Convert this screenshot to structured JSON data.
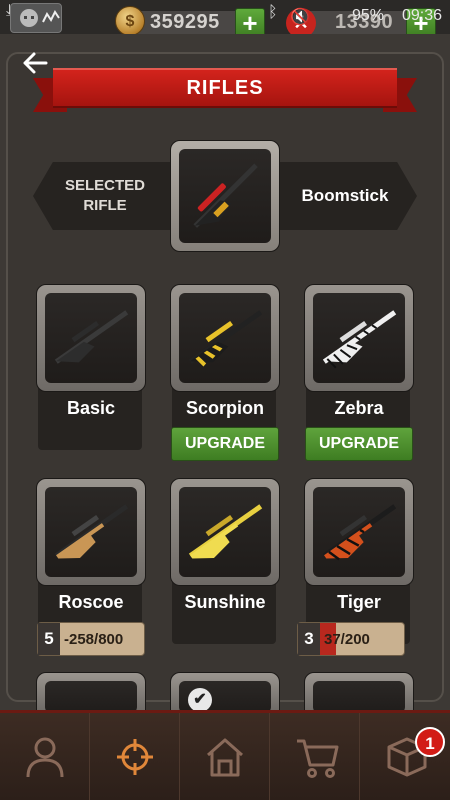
{
  "status_bar": {
    "coins": "359295",
    "tickets": "13390",
    "battery": "95%",
    "time": "09:36",
    "icons": [
      "download-icon",
      "android-app-icon",
      "stats-icon",
      "bluetooth-icon",
      "mute-icon",
      "wifi-icon",
      "signal-icon",
      "battery-icon"
    ]
  },
  "header": {
    "title": "RIFLES",
    "back_icon": "arrow-left-icon"
  },
  "selected": {
    "label": "SELECTED RIFLE",
    "name": "Boomstick"
  },
  "rifles": [
    {
      "name": "Basic",
      "action": null
    },
    {
      "name": "Scorpion",
      "action": "UPGRADE"
    },
    {
      "name": "Zebra",
      "action": "UPGRADE"
    },
    {
      "name": "Roscoe",
      "level": "5",
      "progress_text": "-258/800",
      "progress": 0.0
    },
    {
      "name": "Sunshine",
      "action": null
    },
    {
      "name": "Tiger",
      "level": "3",
      "progress_text": "37/200",
      "progress": 0.185
    }
  ],
  "nav": {
    "items": [
      "profile-icon",
      "crosshair-icon",
      "home-icon",
      "cart-icon",
      "crate-icon"
    ],
    "active": "crosshair-icon",
    "crate_badge": "1"
  },
  "colors": {
    "ribbon": "#c01e17",
    "upgrade_green": "#4f9130",
    "active_nav": "#e0873a"
  }
}
